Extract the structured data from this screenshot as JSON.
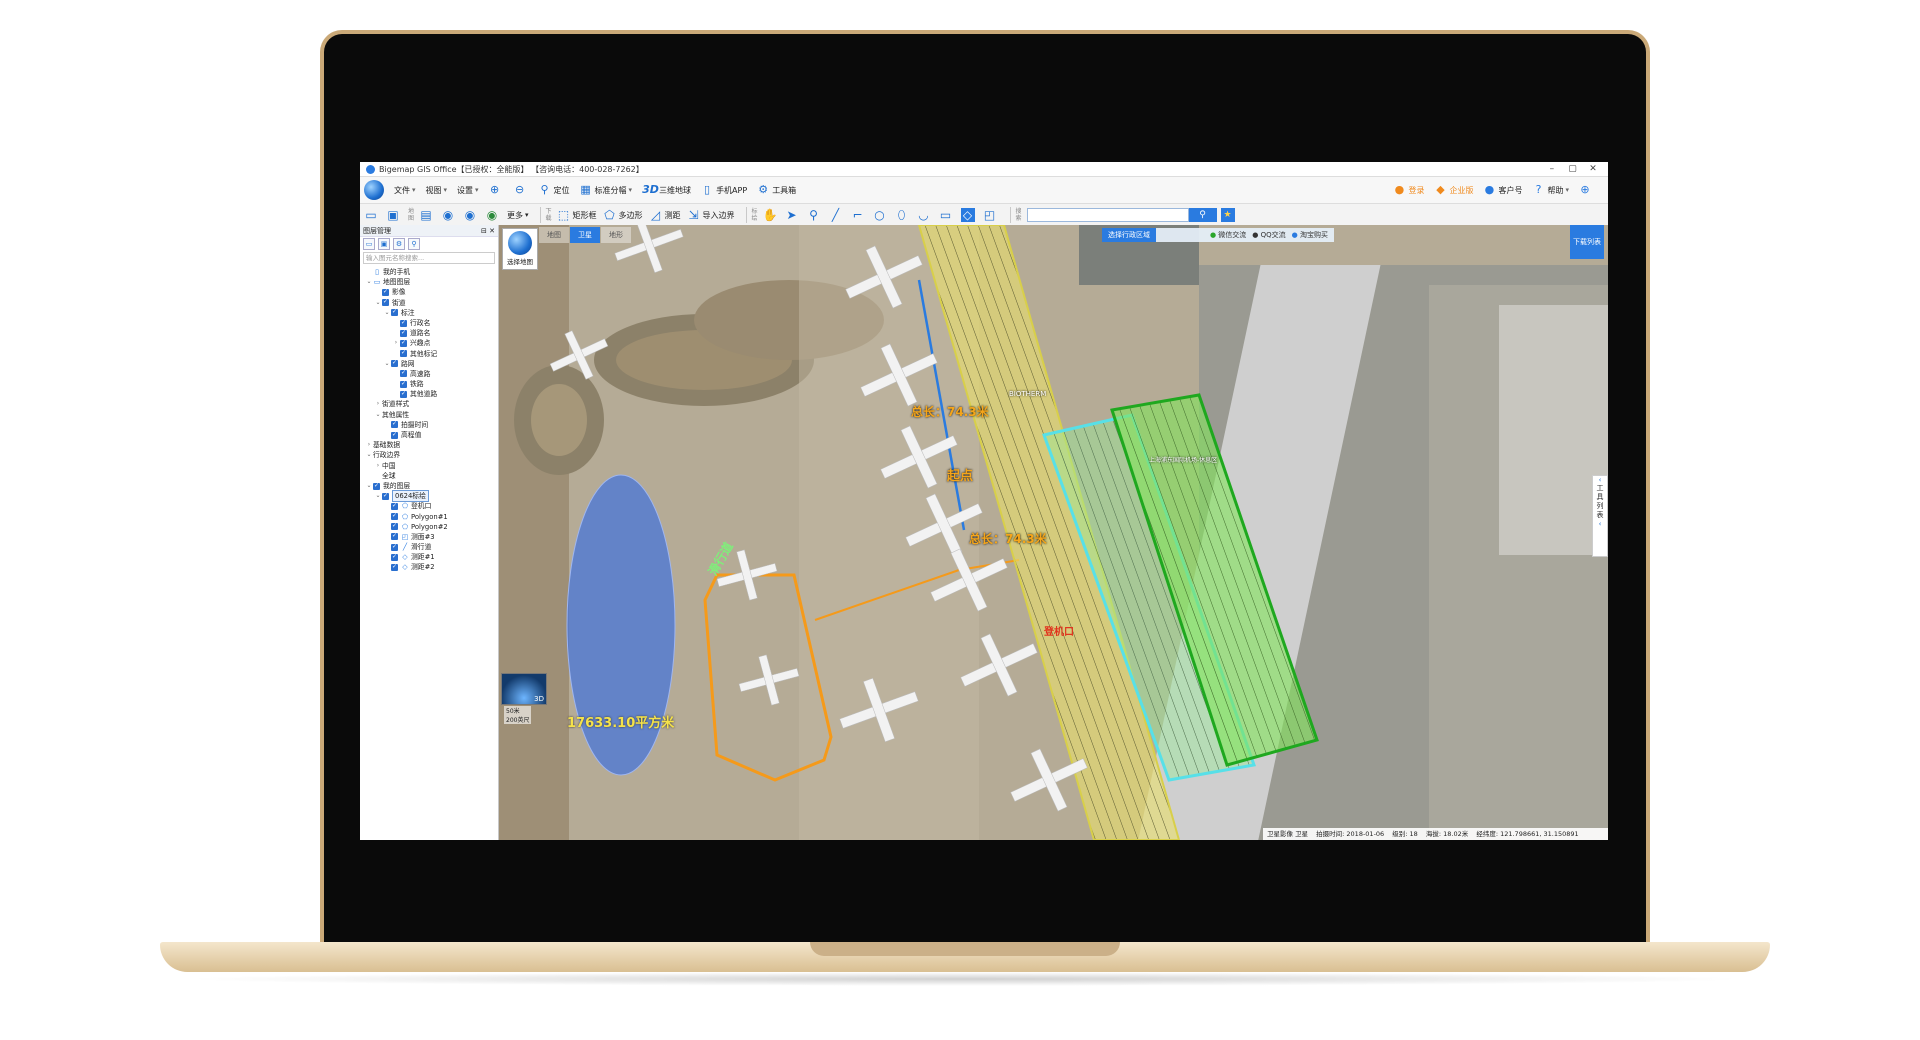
{
  "app": {
    "title": "Bigemap GIS Office【已授权：全能版】 【咨询电话：400-028-7262】"
  },
  "menu": {
    "file": "文件",
    "view": "视图",
    "settings": "设置",
    "locate": "定位",
    "tiles": "标准分幅",
    "three_d": "三维地球",
    "phone_app": "手机APP",
    "toolbox": "工具箱",
    "login": "登录",
    "enterprise": "企业版",
    "customer": "客户号",
    "help": "帮助"
  },
  "toolbar": {
    "more": "更多",
    "download_label": "下载",
    "rect_box": "矩形框",
    "polygon": "多边形",
    "measure": "测距",
    "import_boundary": "导入边界",
    "label_label": "标绘",
    "search_label": "搜索",
    "map_label": "地图",
    "search_placeholder": ""
  },
  "layer_panel": {
    "title": "图层管理",
    "search_placeholder": "输入图元名称搜索...",
    "items": [
      {
        "label": "我的手机",
        "indent": 1,
        "twist": "",
        "cb": false,
        "icon": "phone-icon"
      },
      {
        "label": "地图图层",
        "indent": 1,
        "twist": "⌄",
        "cb": false,
        "icon": "folder-icon"
      },
      {
        "label": "影像",
        "indent": 2,
        "twist": "",
        "cb": true,
        "icon": ""
      },
      {
        "label": "街道",
        "indent": 2,
        "twist": "⌄",
        "cb": true,
        "icon": ""
      },
      {
        "label": "标注",
        "indent": 3,
        "twist": "⌄",
        "cb": true,
        "icon": ""
      },
      {
        "label": "行政名",
        "indent": 4,
        "twist": "",
        "cb": true,
        "icon": ""
      },
      {
        "label": "道路名",
        "indent": 4,
        "twist": "",
        "cb": true,
        "icon": ""
      },
      {
        "label": "兴趣点",
        "indent": 4,
        "twist": "›",
        "cb": true,
        "icon": ""
      },
      {
        "label": "其他标记",
        "indent": 4,
        "twist": "",
        "cb": true,
        "icon": ""
      },
      {
        "label": "路网",
        "indent": 3,
        "twist": "⌄",
        "cb": true,
        "icon": ""
      },
      {
        "label": "高速路",
        "indent": 4,
        "twist": "",
        "cb": true,
        "icon": ""
      },
      {
        "label": "铁路",
        "indent": 4,
        "twist": "",
        "cb": true,
        "icon": ""
      },
      {
        "label": "其他道路",
        "indent": 4,
        "twist": "",
        "cb": true,
        "icon": ""
      },
      {
        "label": "街道样式",
        "indent": 2,
        "twist": "›",
        "cb": false,
        "icon": ""
      },
      {
        "label": "其他属性",
        "indent": 2,
        "twist": "⌄",
        "cb": false,
        "icon": ""
      },
      {
        "label": "拍摄时间",
        "indent": 3,
        "twist": "",
        "cb": true,
        "icon": ""
      },
      {
        "label": "高程值",
        "indent": 3,
        "twist": "",
        "cb": true,
        "icon": ""
      },
      {
        "label": "基础数据",
        "indent": 1,
        "twist": "›",
        "cb": false,
        "icon": ""
      },
      {
        "label": "行政边界",
        "indent": 1,
        "twist": "⌄",
        "cb": false,
        "icon": ""
      },
      {
        "label": "中国",
        "indent": 2,
        "twist": "›",
        "cb": false,
        "icon": ""
      },
      {
        "label": "全球",
        "indent": 2,
        "twist": "",
        "cb": false,
        "icon": ""
      },
      {
        "label": "我的图层",
        "indent": 1,
        "twist": "⌄",
        "cb": true,
        "icon": ""
      },
      {
        "label": "0624标绘",
        "indent": 2,
        "twist": "⌄",
        "cb": true,
        "icon": "",
        "selected": true
      },
      {
        "label": "登机口",
        "indent": 3,
        "twist": "",
        "cb": true,
        "icon": "polygon-icon"
      },
      {
        "label": "Polygon#1",
        "indent": 3,
        "twist": "",
        "cb": true,
        "icon": "polygon-icon"
      },
      {
        "label": "Polygon#2",
        "indent": 3,
        "twist": "",
        "cb": true,
        "icon": "polygon-icon"
      },
      {
        "label": "测面#3",
        "indent": 3,
        "twist": "",
        "cb": true,
        "icon": "area-icon"
      },
      {
        "label": "滑行道",
        "indent": 3,
        "twist": "",
        "cb": true,
        "icon": "line-icon"
      },
      {
        "label": "测距#1",
        "indent": 3,
        "twist": "",
        "cb": true,
        "icon": "ruler-icon"
      },
      {
        "label": "测距#2",
        "indent": 3,
        "twist": "",
        "cb": true,
        "icon": "ruler-icon"
      }
    ]
  },
  "map": {
    "tabs": [
      "地图",
      "卫星",
      "地形"
    ],
    "active_tab": 1,
    "select_map": "选择地图",
    "region_select": "选择行政区域",
    "wechat": "微信交流",
    "qq": "QQ交流",
    "taobao": "淘宝购买",
    "download_list": "下载列表",
    "tool_list": [
      "工",
      "具",
      "列",
      "表"
    ],
    "badge_3d": "3D",
    "scale_top": "50米",
    "scale_bottom": "200英尺",
    "annotations": {
      "area": "17633.10平方米",
      "taxiway": "滑行道",
      "start": "起点",
      "total1": "总长：74.3米",
      "total2": "总长：74.3米",
      "gate": "登机口",
      "biotherm": "BIOTHERM",
      "poi_airport": "上海浦东国际机场-休息区"
    }
  },
  "status": {
    "source": "卫星影像 卫星",
    "date": "拍摄时间: 2018-01-06",
    "level": "级别: 18",
    "altitude": "海拔: 18.02米",
    "coords": "经纬度:  121.798661, 31.150891"
  },
  "colors": {
    "accent": "#2a7be0",
    "yellow_zone": "#e6dc6a",
    "green_zone": "#7fe05a",
    "cyan_outline": "#57e0e8",
    "orange_line": "#f59a1a",
    "blue_area": "#4c77d6"
  }
}
